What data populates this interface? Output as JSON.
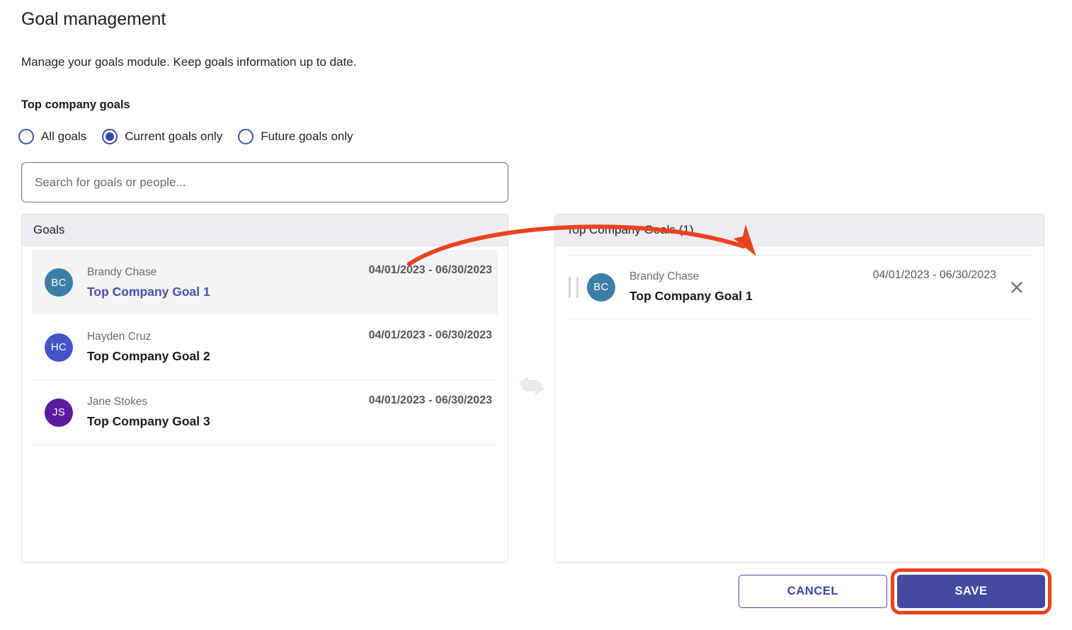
{
  "header": {
    "title": "Goal management",
    "subtitle": "Manage your goals module. Keep goals information up to date.",
    "section_label": "Top company goals"
  },
  "filters": {
    "options": [
      {
        "label": "All goals",
        "checked": false
      },
      {
        "label": "Current goals only",
        "checked": true
      },
      {
        "label": "Future goals only",
        "checked": false
      }
    ]
  },
  "search": {
    "placeholder": "Search for goals or people...",
    "value": ""
  },
  "left_panel": {
    "header": "Goals",
    "rows": [
      {
        "initials": "BC",
        "avatar_color": "#3d7ea8",
        "owner": "Brandy Chase",
        "goal": "Top Company Goal 1",
        "dates": "04/01/2023 - 06/30/2023",
        "selected": true
      },
      {
        "initials": "HC",
        "avatar_color": "#4453c8",
        "owner": "Hayden Cruz",
        "goal": "Top Company Goal 2",
        "dates": "04/01/2023 - 06/30/2023",
        "selected": false
      },
      {
        "initials": "JS",
        "avatar_color": "#5b1b9e",
        "owner": "Jane Stokes",
        "goal": "Top Company Goal 3",
        "dates": "04/01/2023 - 06/30/2023",
        "selected": false
      }
    ]
  },
  "right_panel": {
    "header": "Top Company Goals (1)",
    "rows": [
      {
        "initials": "BC",
        "avatar_color": "#3d7ea8",
        "owner": "Brandy Chase",
        "goal": "Top Company Goal 1",
        "dates": "04/01/2023 - 06/30/2023",
        "remove_icon": "close-icon"
      }
    ]
  },
  "middle": {
    "icon": "swap-arrows-icon"
  },
  "footer": {
    "cancel_label": "CANCEL",
    "save_label": "SAVE"
  },
  "annotations": {
    "arrow_color": "#e8431f",
    "highlight_color": "#e8431f",
    "arrow_note": "curved arrow from selected goal row to top company goals list",
    "highlight_target": "save-button"
  },
  "colors": {
    "accent_blue": "#4550ab",
    "primary_button": "#414a9e",
    "panel_header_bg": "#ededf1",
    "selected_row_bg": "#f4f4f4",
    "annotation_red": "#e8431f"
  }
}
